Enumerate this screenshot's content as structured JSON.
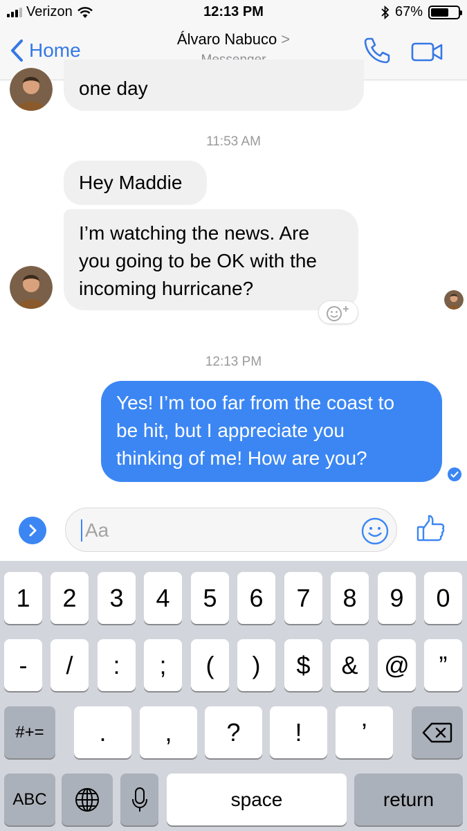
{
  "status_bar": {
    "carrier": "Verizon",
    "time": "12:13 PM",
    "battery": "67%",
    "battery_level": 0.67
  },
  "nav": {
    "back_label": "Home",
    "title": "Álvaro Nabuco",
    "title_chevron": ">",
    "subtitle": "Messenger"
  },
  "messages": {
    "top_fragment": "one day",
    "timestamp_1": "11:53 AM",
    "in_1": "Hey Maddie",
    "in_2_lines": [
      "I’m watching the news. Are",
      "you going to be OK with the",
      "incoming hurricane?"
    ],
    "timestamp_2": "12:13 PM",
    "out_1_lines": [
      "Yes! I’m too far from the coast to",
      "be hit, but I appreciate you",
      "thinking of me! How are you?"
    ]
  },
  "composer": {
    "placeholder": "Aa"
  },
  "keyboard": {
    "row1": [
      "1",
      "2",
      "3",
      "4",
      "5",
      "6",
      "7",
      "8",
      "9",
      "0"
    ],
    "row2": [
      "-",
      "/",
      ":",
      ";",
      "(",
      ")",
      "$",
      "&",
      "@",
      "”"
    ],
    "row3": {
      "symbols": "#+=",
      "keys": [
        ".",
        ",",
        "?",
        "!",
        "’"
      ]
    },
    "row4": {
      "abc": "ABC",
      "space": "space",
      "return": "return"
    }
  },
  "colors": {
    "accent": "#3b86f3",
    "link": "#3578e5",
    "incoming_bubble": "#f1f0f0",
    "keyboard_bg": "#d2d5db"
  }
}
